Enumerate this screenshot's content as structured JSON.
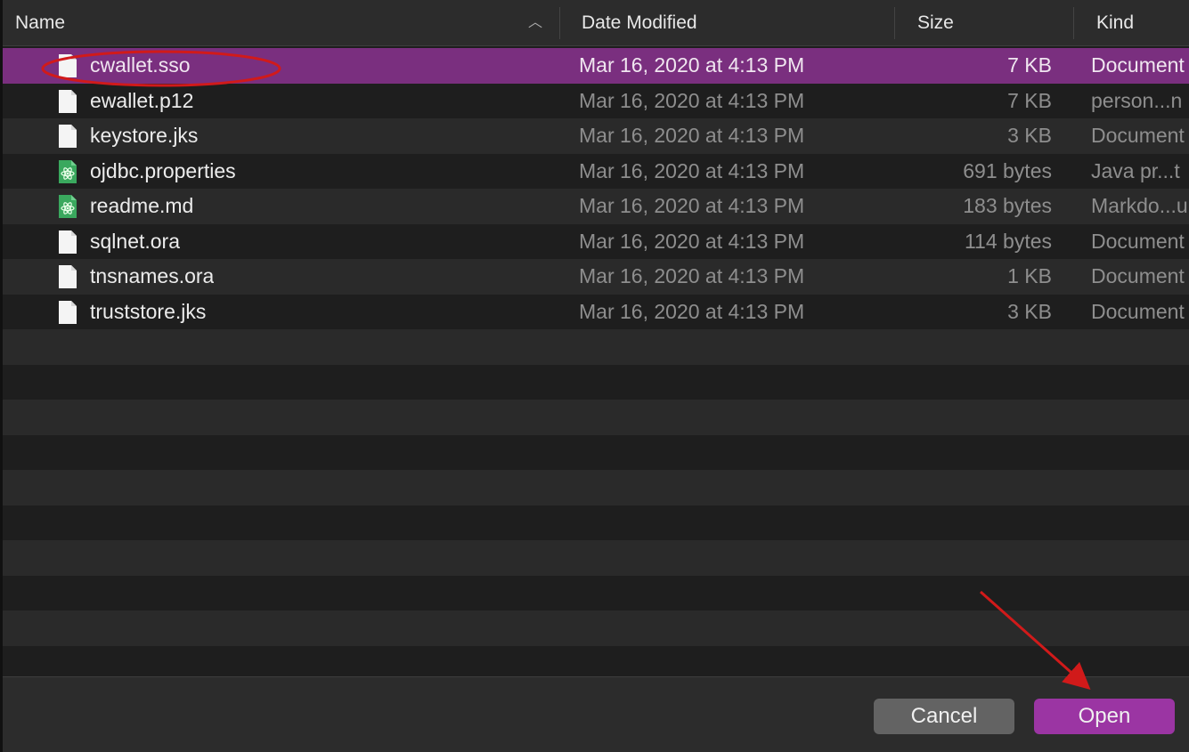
{
  "columns": {
    "name": "Name",
    "date": "Date Modified",
    "size": "Size",
    "kind": "Kind"
  },
  "files": [
    {
      "name": "cwallet.sso",
      "date": "Mar 16, 2020 at 4:13 PM",
      "size": "7 KB",
      "kind": "Document",
      "icon": "document-icon",
      "selected": true
    },
    {
      "name": "ewallet.p12",
      "date": "Mar 16, 2020 at 4:13 PM",
      "size": "7 KB",
      "kind": "person...n",
      "icon": "document-icon"
    },
    {
      "name": "keystore.jks",
      "date": "Mar 16, 2020 at 4:13 PM",
      "size": "3 KB",
      "kind": "Document",
      "icon": "document-icon"
    },
    {
      "name": "ojdbc.properties",
      "date": "Mar 16, 2020 at 4:13 PM",
      "size": "691 bytes",
      "kind": "Java pr...t",
      "icon": "atom-icon"
    },
    {
      "name": "readme.md",
      "date": "Mar 16, 2020 at 4:13 PM",
      "size": "183 bytes",
      "kind": "Markdo...u",
      "icon": "atom-icon"
    },
    {
      "name": "sqlnet.ora",
      "date": "Mar 16, 2020 at 4:13 PM",
      "size": "114 bytes",
      "kind": "Document",
      "icon": "document-icon"
    },
    {
      "name": "tnsnames.ora",
      "date": "Mar 16, 2020 at 4:13 PM",
      "size": "1 KB",
      "kind": "Document",
      "icon": "document-icon"
    },
    {
      "name": "truststore.jks",
      "date": "Mar 16, 2020 at 4:13 PM",
      "size": "3 KB",
      "kind": "Document",
      "icon": "document-icon"
    }
  ],
  "footer": {
    "cancel_label": "Cancel",
    "open_label": "Open"
  },
  "colors": {
    "selection": "#7a2f7f",
    "primary_button": "#9b35a3",
    "annotation": "#d11a1a"
  }
}
